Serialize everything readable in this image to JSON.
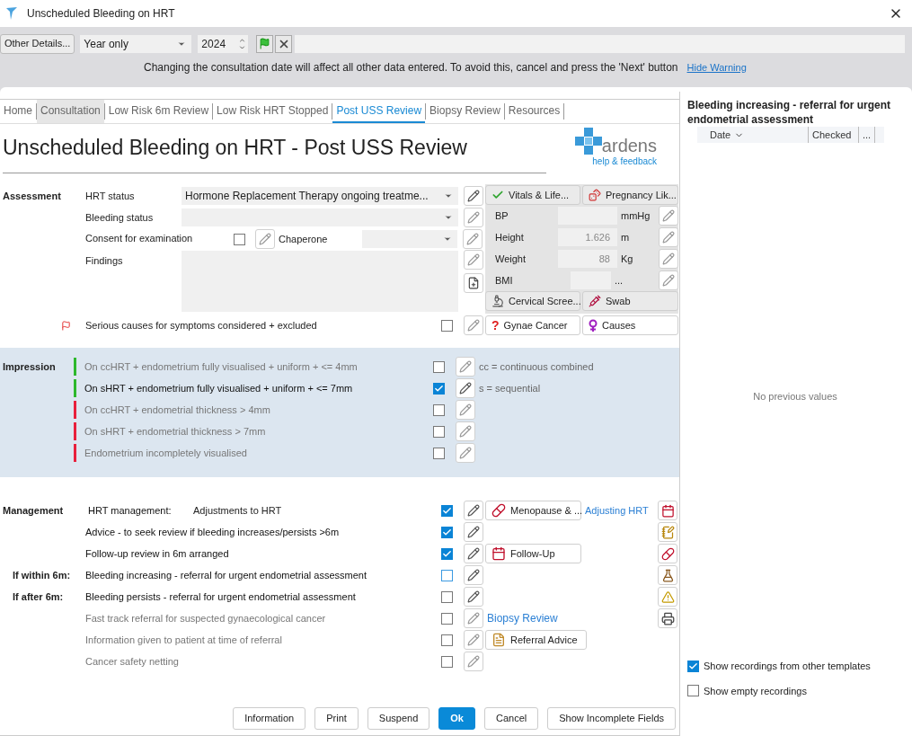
{
  "window": {
    "title": "Unscheduled Bleeding on HRT"
  },
  "toolbar": {
    "other_details_button": "Other Details...",
    "date_mode": "Year only",
    "year": "2024",
    "warning": "Changing the consultation date will affect all other data entered. To avoid this, cancel and press the 'Next' button",
    "hide_warning_link": "Hide Warning"
  },
  "tabs": [
    {
      "label": "Home",
      "selected": false,
      "shaded": false
    },
    {
      "label": "Consultation",
      "selected": false,
      "shaded": true
    },
    {
      "label": "Low Risk 6m Review",
      "selected": false,
      "shaded": false
    },
    {
      "label": "Low Risk HRT Stopped",
      "selected": false,
      "shaded": false
    },
    {
      "label": "Post USS Review",
      "selected": true,
      "shaded": false
    },
    {
      "label": "Biopsy Review",
      "selected": false,
      "shaded": false
    },
    {
      "label": "Resources",
      "selected": false,
      "shaded": false
    }
  ],
  "form_title": "Unscheduled Bleeding on HRT - Post USS Review",
  "logo": {
    "wordmark": "ardens",
    "link": "help & feedback"
  },
  "assessment": {
    "heading": "Assessment",
    "hrt_status": {
      "label": "HRT status",
      "value": "Hormone Replacement Therapy ongoing treatme..."
    },
    "bleeding_status": {
      "label": "Bleeding status"
    },
    "consent": {
      "label": "Consent for examination",
      "checked": false
    },
    "chaperone": {
      "label": "Chaperone"
    },
    "findings": {
      "label": "Findings"
    },
    "serious_causes": {
      "label": "Serious causes for symptoms considered + excluded",
      "checked": false,
      "flagged": true
    },
    "vitals_buttons": [
      {
        "label": "Vitals & Life..."
      },
      {
        "label": "Pregnancy Lik..."
      }
    ],
    "vitals": [
      {
        "label": "BP",
        "unit": "mmHg"
      },
      {
        "label": "Height",
        "value": "1.626",
        "unit": "m"
      },
      {
        "label": "Weight",
        "value": "88",
        "unit": "Kg"
      },
      {
        "label": "BMI",
        "unit": "..."
      }
    ],
    "screening_buttons": [
      {
        "label": "Cervical Scree..."
      },
      {
        "label": "Swab"
      }
    ],
    "info_buttons": [
      {
        "symbol": "?",
        "label": "Gynae Cancer"
      },
      {
        "label": "Causes"
      }
    ]
  },
  "impression": {
    "heading": "Impression",
    "items": [
      {
        "label": "On ccHRT + endometrium fully visualised + uniform + <= 4mm",
        "checked": false,
        "color": "#2db82d",
        "note": "cc = continuous combined"
      },
      {
        "label": "On sHRT + endometrium fully visualised + uniform + <= 7mm",
        "checked": true,
        "color": "#2db82d",
        "note": "s = sequential"
      },
      {
        "label": "On ccHRT + endometrial thickness > 4mm",
        "checked": false,
        "color": "#e8203c"
      },
      {
        "label": "On sHRT + endometrial thickness > 7mm",
        "checked": false,
        "color": "#e8203c"
      },
      {
        "label": "Endometrium incompletely visualised",
        "checked": false,
        "color": "#e8203c"
      }
    ]
  },
  "management": {
    "heading": "Management",
    "rows": [
      {
        "label": "HRT management:",
        "value": "Adjustments to HRT",
        "checked": true,
        "dimmed": false,
        "action": {
          "kind": "button",
          "label": "Menopause & ..."
        },
        "link": "Adjusting HRT"
      },
      {
        "label": "Advice - to seek review if bleeding increases/persists >6m",
        "checked": true,
        "dimmed": false
      },
      {
        "label": "Follow-up review in 6m arranged",
        "checked": true,
        "dimmed": false,
        "action": {
          "kind": "button",
          "label": "Follow-Up"
        }
      },
      {
        "prefix": "If within 6m:",
        "label": "Bleeding increasing - referral for urgent endometrial assessment",
        "checked": false,
        "dimmed": false
      },
      {
        "prefix": "If after 6m:",
        "label": "Bleeding persists - referral for urgent endometrial assessment",
        "checked": false,
        "dimmed": false
      },
      {
        "label": "Fast track referral for suspected gynaecological cancer",
        "checked": false,
        "dimmed": true,
        "action": {
          "kind": "link",
          "label": "Biopsy Review"
        }
      },
      {
        "label": "Information given to patient at time of referral",
        "checked": false,
        "dimmed": true,
        "action": {
          "kind": "button",
          "label": "Referral Advice"
        }
      },
      {
        "label": "Cancer safety netting",
        "checked": false,
        "dimmed": true
      }
    ]
  },
  "footer_buttons": [
    {
      "label": "Information",
      "primary": false
    },
    {
      "label": "Print",
      "primary": false
    },
    {
      "label": "Suspend",
      "primary": false
    },
    {
      "label": "Ok",
      "primary": true
    },
    {
      "label": "Cancel",
      "primary": false
    },
    {
      "label": "Show Incomplete Fields",
      "primary": false
    }
  ],
  "history": {
    "title": "Bleeding increasing - referral for urgent endometrial assessment",
    "columns": [
      {
        "label": "Date"
      },
      {
        "label": "Checked"
      },
      {
        "label": "..."
      }
    ],
    "empty_message": "No previous values",
    "options": [
      {
        "label": "Show recordings from other templates",
        "checked": true
      },
      {
        "label": "Show empty recordings",
        "checked": false
      }
    ]
  }
}
